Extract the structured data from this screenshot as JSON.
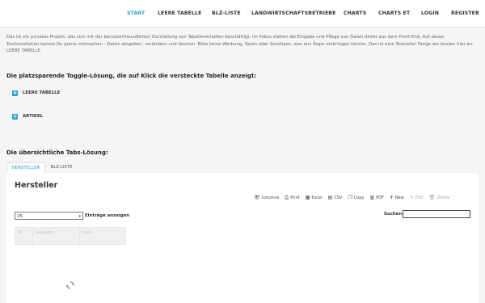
{
  "nav": {
    "items": [
      {
        "label": "START",
        "active": true
      },
      {
        "label": "LEERE TABELLE",
        "active": false
      },
      {
        "label": "BLZ-LISTE",
        "active": false
      },
      {
        "label": "LANDWIRTSCHAFTSBETRIEBE",
        "active": false
      },
      {
        "label": "CHARTS",
        "active": false
      },
      {
        "label": "CHARTS ET",
        "active": false
      },
      {
        "label": "LOGIN",
        "active": false
      },
      {
        "label": "REGISTER",
        "active": false
      }
    ]
  },
  "intro": {
    "text": "Das ist ein privates Projekt, das sich mit der benutzerfreundlichen Darstellung von Tabelleninhalten beschäftigt. Im Fokus stehen die Eingabe und Pflege von Daten direkt aus dem Front-End. Auf dieser Testinstallation kannst Du gerne mitmachen - Daten eingeben, verändern und löschen. Bitte keine Werbung, Spam oder Sonstiges, was uns Ärger einbringen könnte. Das ist eine Testseite! Fange am besten hier an: LEERE TABELLE."
  },
  "toggle_section": {
    "heading": "Die platzsparende Toggle-Lösung, die auf Klick die versteckte Tabelle anzeigt:",
    "items": [
      {
        "label": "LEERE TABELLE",
        "icon": "plus-icon"
      },
      {
        "label": "ARTIKEL",
        "icon": "plus-icon"
      }
    ]
  },
  "tabs_section": {
    "heading": "Die übersichtliche Tabs-Lösung:",
    "tabs": [
      {
        "label": "HERSTELLER",
        "active": true
      },
      {
        "label": "BLZ-LISTE",
        "active": false
      }
    ]
  },
  "panel": {
    "title": "Hersteller",
    "toolbar": [
      {
        "label": "Columns",
        "icon": "eye-icon",
        "enabled": true
      },
      {
        "label": "Print",
        "icon": "print-icon",
        "enabled": true
      },
      {
        "label": "Excel",
        "icon": "excel-icon",
        "enabled": true
      },
      {
        "label": "CSV",
        "icon": "csv-icon",
        "enabled": true
      },
      {
        "label": "Copy",
        "icon": "copy-icon",
        "enabled": true
      },
      {
        "label": "PDF",
        "icon": "pdf-icon",
        "enabled": true
      },
      {
        "label": "New",
        "icon": "plus-icon",
        "enabled": true
      },
      {
        "label": "Edit",
        "icon": "pencil-icon",
        "enabled": false
      },
      {
        "label": "Delete",
        "icon": "trash-icon",
        "enabled": false
      }
    ],
    "page_length": "25",
    "entries_label": "Einträge anzeigen",
    "search_label": "Suchen",
    "search_value": "",
    "columns": [
      "ID",
      "Hersteller",
      "Land"
    ]
  }
}
